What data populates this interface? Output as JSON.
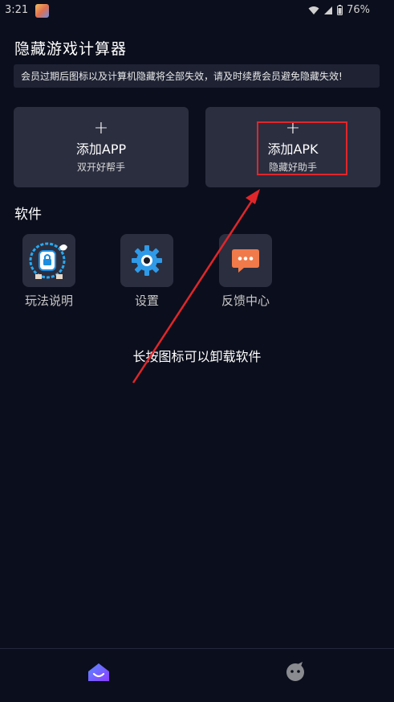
{
  "status_bar": {
    "time": "3:21",
    "battery": "76%"
  },
  "header": {
    "title": "隐藏游戏计算器"
  },
  "notice": {
    "text": "会员过期后图标以及计算机隐藏将全部失效，请及时续费会员避免隐藏失效!"
  },
  "add_cards": [
    {
      "plus": "+",
      "title": "添加APP",
      "subtitle": "双开好帮手"
    },
    {
      "plus": "+",
      "title": "添加APK",
      "subtitle": "隐藏好助手"
    }
  ],
  "section": {
    "title": "软件"
  },
  "apps": [
    {
      "label": "玩法说明",
      "icon": "guide-icon"
    },
    {
      "label": "设置",
      "icon": "gear-icon"
    },
    {
      "label": "反馈中心",
      "icon": "chat-bubble-icon"
    }
  ],
  "hint": {
    "text": "长按图标可以卸载软件"
  },
  "bottom_nav": {
    "items": [
      {
        "icon": "home-icon",
        "active": true
      },
      {
        "icon": "profile-icon",
        "active": false
      }
    ]
  },
  "colors": {
    "background": "#0b0e1c",
    "card": "#2b2e3f",
    "highlight": "#e0262a",
    "accent": "#6a4cff"
  }
}
